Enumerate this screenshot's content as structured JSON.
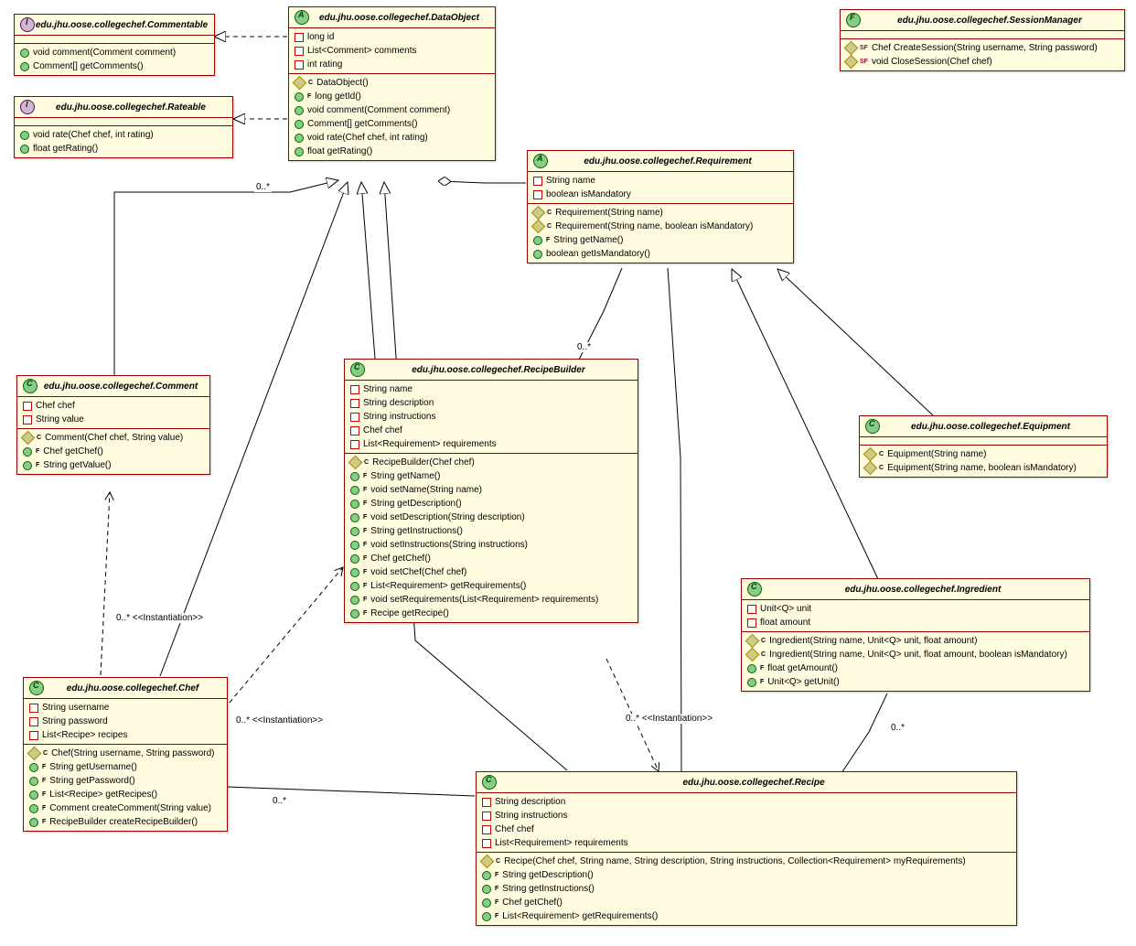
{
  "classes": {
    "commentable": {
      "title": "edu.jhu.oose.collegechef.Commentable",
      "members": [
        "void comment(Comment comment)",
        "Comment[] getComments()"
      ]
    },
    "rateable": {
      "title": "edu.jhu.oose.collegechef.Rateable",
      "members": [
        "void rate(Chef chef, int rating)",
        "float getRating()"
      ]
    },
    "dataobject": {
      "title": "edu.jhu.oose.collegechef.DataObject",
      "fields": [
        "long id",
        "List<Comment> comments",
        "int rating"
      ],
      "methods": [
        "DataObject()",
        "long getId()",
        "void comment(Comment comment)",
        "Comment[] getComments()",
        "void rate(Chef chef, int rating)",
        "float getRating()"
      ]
    },
    "sessionmanager": {
      "title": "edu.jhu.oose.collegechef.SessionManager",
      "methods": [
        "Chef CreateSession(String username, String password)",
        "void CloseSession(Chef chef)"
      ]
    },
    "requirement": {
      "title": "edu.jhu.oose.collegechef.Requirement",
      "fields": [
        "String name",
        "boolean isMandatory"
      ],
      "methods": [
        "Requirement(String name)",
        "Requirement(String name, boolean isMandatory)",
        "String getName()",
        "boolean getIsMandatory()"
      ]
    },
    "comment": {
      "title": "edu.jhu.oose.collegechef.Comment",
      "fields": [
        "Chef chef",
        "String value"
      ],
      "methods": [
        "Comment(Chef chef, String value)",
        "Chef getChef()",
        "String getValue()"
      ]
    },
    "recipebuilder": {
      "title": "edu.jhu.oose.collegechef.RecipeBuilder",
      "fields": [
        "String name",
        "String description",
        "String instructions",
        "Chef chef",
        "List<Requirement> requirements"
      ],
      "methods": [
        "RecipeBuilder(Chef chef)",
        "String getName()",
        "void setName(String name)",
        "String getDescription()",
        "void setDescription(String description)",
        "String getInstructions()",
        "void setInstructions(String instructions)",
        "Chef getChef()",
        "void setChef(Chef chef)",
        "List<Requirement> getRequirements()",
        "void setRequirements(List<Requirement> requirements)",
        "Recipe getRecipe()"
      ]
    },
    "equipment": {
      "title": "edu.jhu.oose.collegechef.Equipment",
      "methods": [
        "Equipment(String name)",
        "Equipment(String name, boolean isMandatory)"
      ]
    },
    "ingredient": {
      "title": "edu.jhu.oose.collegechef.Ingredient",
      "fields": [
        "Unit<Q> unit",
        "float amount"
      ],
      "methods": [
        "Ingredient(String name, Unit<Q> unit, float amount)",
        "Ingredient(String name, Unit<Q> unit, float amount, boolean isMandatory)",
        "float getAmount()",
        "Unit<Q> getUnit()"
      ]
    },
    "chef": {
      "title": "edu.jhu.oose.collegechef.Chef",
      "fields": [
        "String username",
        "String password",
        "List<Recipe> recipes"
      ],
      "methods": [
        "Chef(String username, String password)",
        "String getUsername()",
        "String getPassword()",
        "List<Recipe> getRecipes()",
        "Comment createComment(String value)",
        "RecipeBuilder createRecipeBuilder()"
      ]
    },
    "recipe": {
      "title": "edu.jhu.oose.collegechef.Recipe",
      "fields": [
        "String description",
        "String instructions",
        "Chef chef",
        "List<Requirement> requirements"
      ],
      "methods": [
        "Recipe(Chef chef, String name, String description, String instructions, Collection<Requirement> myRequirements)",
        "String getDescription()",
        "String getInstructions()",
        "Chef getChef()",
        "List<Requirement> getRequirements()"
      ]
    }
  },
  "labels": {
    "inst1": "0..*  <<Instantiation>>",
    "inst2": "0..*  <<Instantiation>>",
    "inst3": "0..*  <<Instantiation>>",
    "m1": "0..*",
    "m2": "0..*",
    "m3": "0..*",
    "m4": "0..*"
  }
}
